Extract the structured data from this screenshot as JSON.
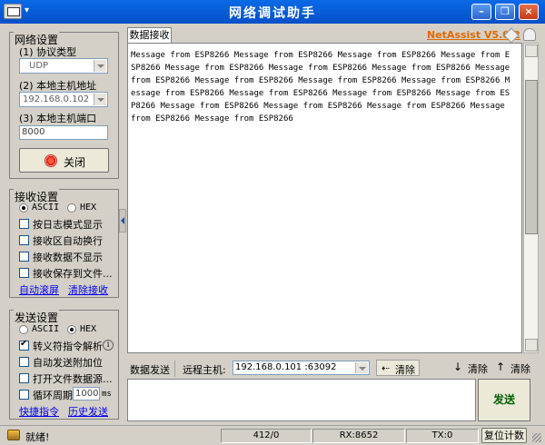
{
  "window": {
    "title": "网络调试助手",
    "menu_glyph": "▾",
    "minimize_glyph": "–",
    "restore_glyph": "❐",
    "close_glyph": "×"
  },
  "network": {
    "title": "网络设置",
    "protocol_label": "(1) 协议类型",
    "protocol_value": "UDP",
    "host_label": "(2) 本地主机地址",
    "host_value": "192.168.0.102",
    "port_label": "(3) 本地主机端口",
    "port_value": "8000",
    "close_button": "关闭"
  },
  "receive": {
    "title": "接收设置",
    "ascii_label": "ASCII",
    "hex_label": "HEX",
    "selected": "ASCII",
    "options": [
      {
        "label": "按日志模式显示",
        "checked": false
      },
      {
        "label": "接收区自动换行",
        "checked": false
      },
      {
        "label": "接收数据不显示",
        "checked": false
      },
      {
        "label": "接收保存到文件...",
        "checked": false
      }
    ],
    "auto_scroll_link": "自动滚屏",
    "clear_link": "清除接收"
  },
  "send": {
    "title": "发送设置",
    "ascii_label": "ASCII",
    "hex_label": "HEX",
    "selected": "HEX",
    "options": [
      {
        "label": "转义符指令解析",
        "checked": true
      },
      {
        "label": "自动发送附加位",
        "checked": false
      },
      {
        "label": "打开文件数据源...",
        "checked": false
      },
      {
        "label": "循环周期",
        "checked": false
      }
    ],
    "cycle_value": "1000",
    "cycle_unit": "ms",
    "shortcut_link": "快捷指令",
    "history_link": "历史发送",
    "info_glyph": "i"
  },
  "data_area": {
    "tab_label": "数据接收",
    "brand": "NetAssist V5.0.2",
    "received_text": "Message from ESP8266 Message from ESP8266 Message from ESP8266 Message from ESP8266 Message from ESP8266 Message from ESP8266 Message from ESP8266 Message from ESP8266 Message from ESP8266 Message from ESP8266 Message from ESP8266 Message from ESP8266 Message from ESP8266 Message from ESP8266 Message from ESP8266 Message from ESP8266 Message from ESP8266 Message from ESP8266 Message from ESP8266 Message from ESP8266"
  },
  "send_area": {
    "tab_label": "数据发送",
    "remote_label": "远程主机:",
    "remote_value": "192.168.0.101 :63092",
    "clear1": "清除",
    "clear2": "清除",
    "clear3": "清除",
    "send_button": "发送"
  },
  "status": {
    "ready": "就绪!",
    "count": "412/0",
    "rx": "RX:8652",
    "tx": "TX:0",
    "reset_button": "复位计数"
  }
}
